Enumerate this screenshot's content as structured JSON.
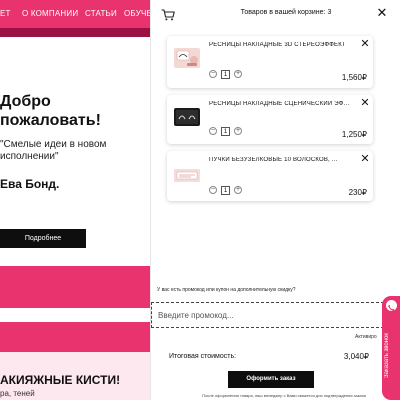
{
  "background_page": {
    "nav": {
      "items": [
        "ЕТ",
        "О КОМПАНИИ",
        "СТАТЬИ",
        "ОБУЧЕНИ"
      ]
    },
    "hero": {
      "heading": "Добро пожаловать!",
      "quote": "\"Смелые идеи в новом исполнении\"",
      "author": "Ева Бонд.",
      "more_button": "Подробнее"
    },
    "promo": {
      "title": "АКИЯЖНЫЕ КИСТИ!",
      "subtitle": "ра, теней"
    }
  },
  "cart": {
    "count_label": "Товаров в вашей корзине: 3",
    "items": [
      {
        "name": "РЕСНИЦЫ НАКЛАДНЫЕ 3D СТЕРЕОЭФФЕКТ",
        "qty": "1",
        "price": "1,560₽"
      },
      {
        "name": "РЕСНИЦЫ НАКЛАДНЫЕ СЦЕНИЧЕСКИЙ ЭФФЕКТ",
        "qty": "1",
        "price": "1,250₽"
      },
      {
        "name": "ПУЧКИ БЕЗУЗЕЛКОВЫЕ 10 ВОЛОСКОВ, ...",
        "qty": "1",
        "price": "230₽"
      }
    ],
    "qty_minus": "−",
    "qty_plus": "+",
    "remove": "✕",
    "promo_question": "У вас есть промокод или купон на дополнительную скидку?",
    "promo_placeholder": "Введите промокод...",
    "apply_label": "Активиро",
    "total_label": "Итоговая стоимость:",
    "total_value": "3,040₽",
    "checkout_label": "Оформить заказ",
    "consent": "После оформления товара, наш менеджер с Вами свяжется для подтверждения заказа",
    "close": "✕"
  },
  "side_tab": {
    "label": "Заказать звонок"
  },
  "colors": {
    "brand_pink": "#e8336f",
    "dark_pink": "#9b1146",
    "light_pink": "#fde8ef",
    "button_black": "#0e0e0e"
  },
  "icons": {
    "cart": "cart-icon",
    "close": "close-icon",
    "remove": "close-icon",
    "phone": "phone-icon"
  }
}
